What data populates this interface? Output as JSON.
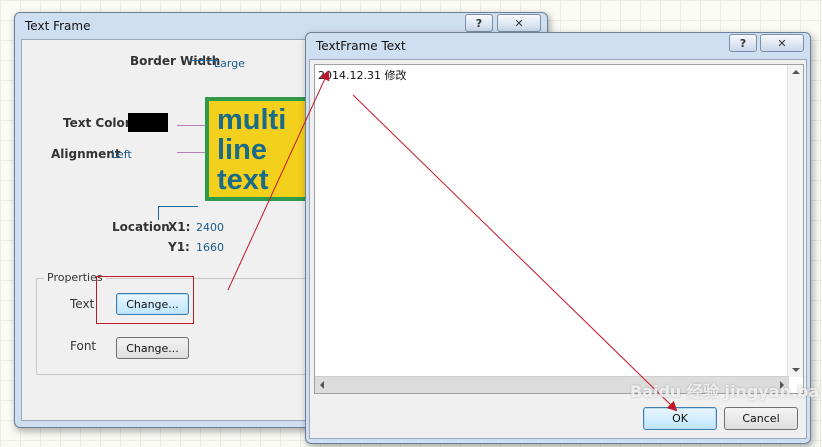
{
  "textframe_dialog": {
    "title": "Text Frame",
    "help": "?",
    "close": "✕",
    "border_width_label": "Border Width",
    "border_width_value": "Large",
    "text_color_label": "Text Color",
    "text_color_swatch": "#000000",
    "alignment_label": "Alignment",
    "alignment_value": "Left",
    "preview_lines": [
      "multi",
      "line",
      "text"
    ],
    "preview_bg": "#f2d01c",
    "preview_border": "#2f9a4a",
    "preview_text_color": "#1a6a8a",
    "location_label": "Location",
    "x1_label": "X1:",
    "x1_value": "2400",
    "y1_label": "Y1:",
    "y1_value": "1660",
    "properties_group": "Properties",
    "text_label": "Text",
    "text_change": "Change...",
    "font_label": "Font",
    "font_change": "Change..."
  },
  "text_editor_dialog": {
    "title": "TextFrame Text",
    "help": "?",
    "close": "✕",
    "content": "2014.12.31 修改",
    "ok": "OK",
    "cancel": "Cancel"
  },
  "annotation_color": "#c0182a",
  "watermark": "Baidu 经验  jingyan.baidu.com"
}
